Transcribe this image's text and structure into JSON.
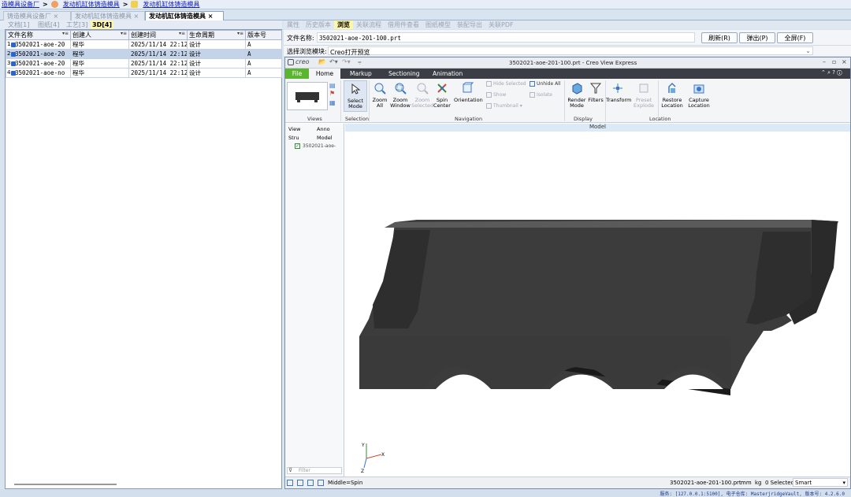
{
  "breadcrumb": {
    "items": [
      "造模具设备厂",
      "发动机缸体铸造模具",
      "发动机缸体铸造模具"
    ],
    "separator": ">"
  },
  "top_tabs": [
    {
      "label": "铸造模具设备厂",
      "active": false
    },
    {
      "label": "发动机缸体铸造模具",
      "active": false
    },
    {
      "label": "发动机缸体铸造模具",
      "active": true
    }
  ],
  "doc_tabs": [
    {
      "label": "文档[1]",
      "active": false
    },
    {
      "label": "图纸[4]",
      "active": false
    },
    {
      "label": "工艺[3]",
      "active": false
    },
    {
      "label": "3D[4]",
      "active": true
    }
  ],
  "table": {
    "columns": [
      "文件名称",
      "创建人",
      "创建时间",
      "生命周期",
      "版本号"
    ],
    "rows": [
      {
        "num": "1",
        "name": "3502021-aoe-20",
        "creator": "程华",
        "time": "2025/11/14 22:12",
        "stage": "设计",
        "ver": "A"
      },
      {
        "num": "2",
        "name": "3502021-aoe-20",
        "creator": "程华",
        "time": "2025/11/14 22:12",
        "stage": "设计",
        "ver": "A"
      },
      {
        "num": "3",
        "name": "3502021-aoe-20",
        "creator": "程华",
        "time": "2025/11/14 22:12",
        "stage": "设计",
        "ver": "A"
      },
      {
        "num": "4",
        "name": "3502021-aoe-no",
        "creator": "程华",
        "time": "2025/11/14 22:12",
        "stage": "设计",
        "ver": "A"
      }
    ]
  },
  "right_tabs": [
    {
      "label": "属性",
      "active": false
    },
    {
      "label": "历史版本",
      "active": false
    },
    {
      "label": "浏览",
      "active": true
    },
    {
      "label": "关联流程",
      "active": false
    },
    {
      "label": "借用件查看",
      "active": false
    },
    {
      "label": "图纸模型",
      "active": false
    },
    {
      "label": "装配导出",
      "active": false
    },
    {
      "label": "关联PDF",
      "active": false
    }
  ],
  "file_row": {
    "label": "文件名称:",
    "value": "3502021-aoe-201-100.prt",
    "buttons": [
      "刷新(R)",
      "弹出(P)",
      "全屏(F)"
    ]
  },
  "module_row": {
    "label": "选择浏览模块:",
    "value": "Creo打开预览"
  },
  "creo": {
    "logo": "creo",
    "title": "3502021-aoe-201-100.prt - Creo View Express",
    "menu": [
      "File",
      "Home",
      "Markup",
      "Sectioning",
      "Animation"
    ],
    "ribbon": {
      "select": "Select\nMode",
      "zoom_all": "Zoom\nAll",
      "zoom_window": "Zoom\nWindow",
      "zoom_selected": "Zoom\nSelected",
      "spin_center": "Spin\nCenter",
      "orientation": "Orientation",
      "hide_selected": "Hide Selected",
      "unhide_all": "Unhide All",
      "show": "Show",
      "isolate": "Isolate",
      "thumbnail": "Thumbnail",
      "render_mode": "Render\nMode",
      "filters": "Filters",
      "transform": "Transform",
      "preset_explode": "Preset\nExplode",
      "restore_location": "Restore\nLocation",
      "capture_location": "Capture\nLocation",
      "groups": [
        "Views",
        "Selection",
        "Navigation",
        "Display",
        "Location"
      ]
    },
    "tree_tabs": [
      "View",
      "Anno",
      "Stru",
      "Model"
    ],
    "tree_item": "3502021-aoe-",
    "filter_placeholder": "Filter",
    "model_header": "Model",
    "axes": {
      "x": "X",
      "y": "Y",
      "z": "Z"
    },
    "status": {
      "mode": "Middle=Spin",
      "file": "3502021-aoe-201-100.prt",
      "units1": "mm",
      "units2": "kg",
      "selected": "0 Selected",
      "smart": "Smart"
    }
  },
  "footer": "服务: [127.0.0.1:5100], 电子仓库: MasterjridgeVault, 版本号: 4.2.6.0",
  "colors": {
    "accent_tab": "#fff7a8",
    "file_menu": "#5cb531",
    "menu_bar": "#3b3f45",
    "selection": "#c3d3ea"
  }
}
